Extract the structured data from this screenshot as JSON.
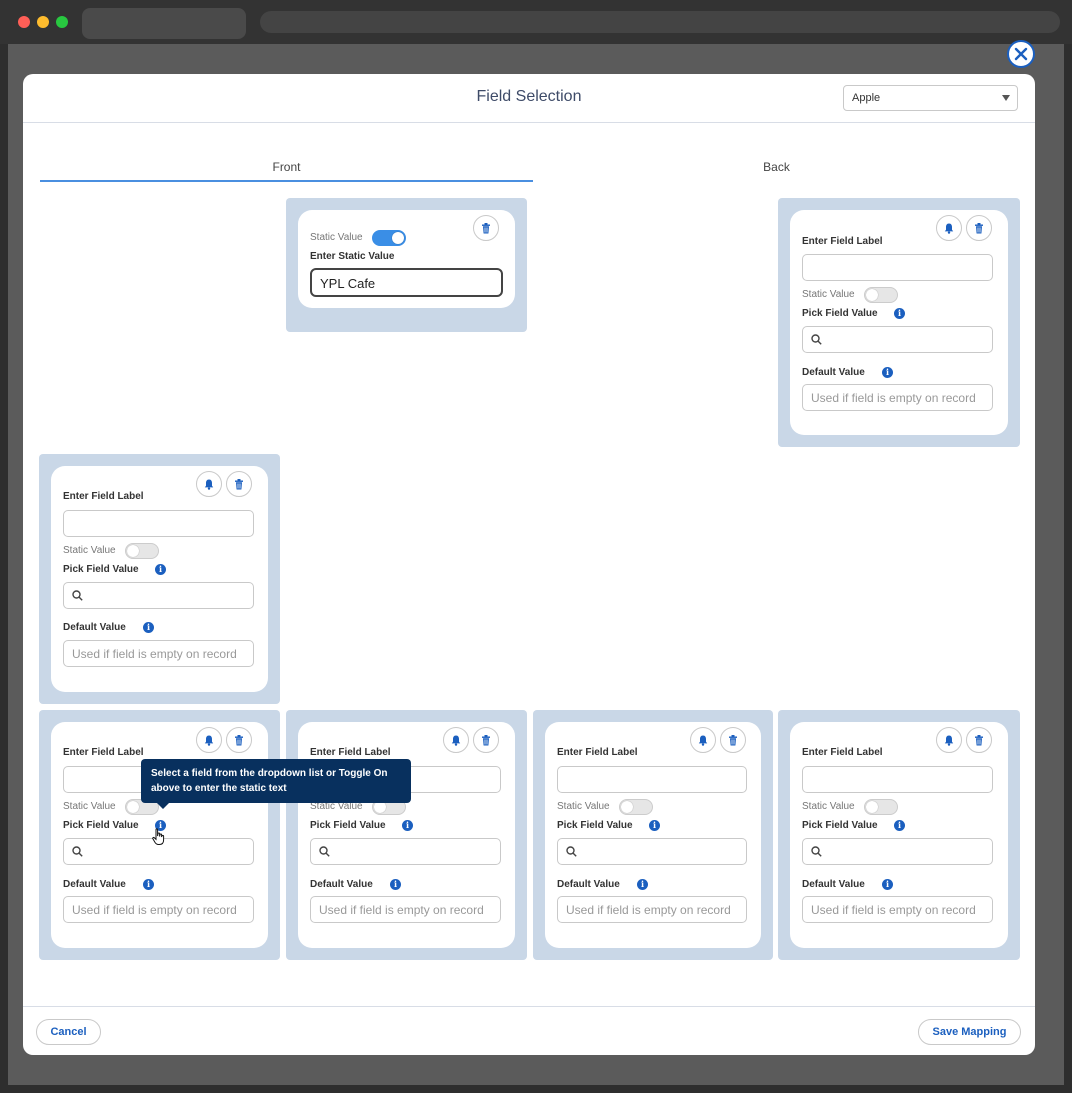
{
  "modal": {
    "title": "Field Selection",
    "select_value": "Apple"
  },
  "tabs": {
    "front": "Front",
    "back": "Back"
  },
  "labels": {
    "static_value": "Static Value",
    "enter_static_value": "Enter Static Value",
    "enter_field_label": "Enter Field Label",
    "pick_field_value": "Pick Field Value",
    "default_value": "Default Value",
    "info_glyph": "i"
  },
  "placeholders": {
    "default_value": "Used if field is empty on record"
  },
  "static_card": {
    "value": "YPL Cafe"
  },
  "tooltip": {
    "text": "Select a field from the dropdown list or Toggle On above to enter the static text"
  },
  "footer": {
    "cancel": "Cancel",
    "save": "Save Mapping"
  },
  "colors": {
    "accent": "#1b5fbf",
    "toggle_on": "#3a8ee6",
    "slot_bg": "#c9d7e7",
    "tooltip_bg": "#08305e"
  },
  "icons": [
    "close-icon",
    "bell-icon",
    "trash-icon",
    "search-icon",
    "info-icon",
    "chevron-down-icon",
    "hand-pointer-icon"
  ]
}
